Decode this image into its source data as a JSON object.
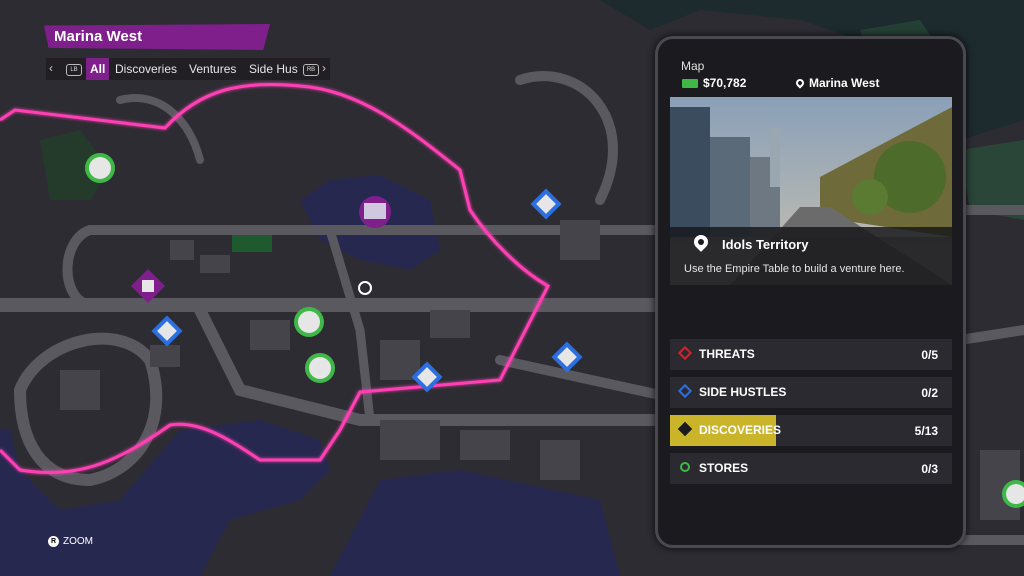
{
  "region_title": "Marina West",
  "filters": {
    "left_hint": "LB",
    "right_hint": "RB",
    "tabs": [
      "All",
      "Discoveries",
      "Ventures",
      "Side Hus"
    ]
  },
  "zoom_hint": {
    "button": "R",
    "label": "ZOOM"
  },
  "phone": {
    "header": "Map",
    "money": "$70,782",
    "location": "Marina West",
    "venture": {
      "title": "Idols Territory",
      "description": "Use the Empire Table to build a venture here."
    },
    "categories": [
      {
        "label": "THREATS",
        "count": "0/5",
        "icon": "diamond-icon",
        "color": "#d2232a"
      },
      {
        "label": "SIDE HUSTLES",
        "count": "0/2",
        "icon": "diamond-icon",
        "color": "#2b6fe0"
      },
      {
        "label": "DISCOVERIES",
        "count": "5/13",
        "icon": "diamond-icon",
        "color": "#c9b42a"
      },
      {
        "label": "STORES",
        "count": "0/3",
        "icon": "shield-icon",
        "color": "#3fb848"
      }
    ]
  },
  "colors": {
    "territory_border": "#ff3fb4",
    "accent": "#7e1f8c",
    "water": "#27284f",
    "land": "#3b3a40"
  }
}
